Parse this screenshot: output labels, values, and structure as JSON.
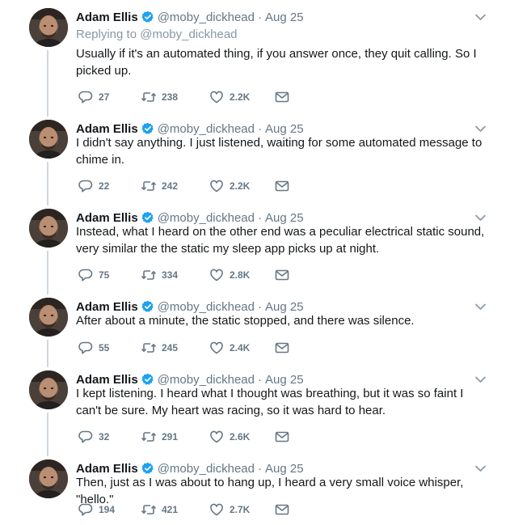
{
  "tweets": [
    {
      "name": "Adam Ellis",
      "handle": "@moby_dickhead",
      "separator": "·",
      "date": "Aug 25",
      "replying_label": "Replying to",
      "replying_handle": "@moby_dickhead",
      "text": "Usually if it's an automated thing, if you answer once, they quit calling. So I picked up.",
      "replies": "27",
      "retweets": "238",
      "likes": "2.2K"
    },
    {
      "name": "Adam Ellis",
      "handle": "@moby_dickhead",
      "separator": "·",
      "date": "Aug 25",
      "text": "I didn't say anything. I just listened, waiting for some automated message to chime in.",
      "replies": "22",
      "retweets": "242",
      "likes": "2.2K"
    },
    {
      "name": "Adam Ellis",
      "handle": "@moby_dickhead",
      "separator": "·",
      "date": "Aug 25",
      "text": "Instead, what I heard on the other end was a peculiar electrical static sound, very similar the the static my sleep app picks up at night.",
      "replies": "75",
      "retweets": "334",
      "likes": "2.8K"
    },
    {
      "name": "Adam Ellis",
      "handle": "@moby_dickhead",
      "separator": "·",
      "date": "Aug 25",
      "text": "After about a minute, the static stopped, and there was silence.",
      "replies": "55",
      "retweets": "245",
      "likes": "2.4K"
    },
    {
      "name": "Adam Ellis",
      "handle": "@moby_dickhead",
      "separator": "·",
      "date": "Aug 25",
      "text": "I kept listening. I heard what I thought was breathing, but it was so faint I can't be sure. My heart was racing, so it was hard to hear.",
      "replies": "32",
      "retweets": "291",
      "likes": "2.6K"
    },
    {
      "name": "Adam Ellis",
      "handle": "@moby_dickhead",
      "separator": "·",
      "date": "Aug 25",
      "text": "Then, just as I was about to hang up, I heard a very small voice whisper, \"hello.\"",
      "replies": "194",
      "retweets": "421",
      "likes": "2.7K"
    }
  ],
  "colors": {
    "text": "#14171a",
    "secondary": "#657786",
    "verified": "#1da1f2",
    "thread_line": "#cfd8dc"
  },
  "icons": {
    "reply": "reply-icon",
    "retweet": "retweet-icon",
    "like": "heart-icon",
    "message": "envelope-icon",
    "menu": "chevron-down-icon",
    "verified": "verified-badge-icon"
  }
}
